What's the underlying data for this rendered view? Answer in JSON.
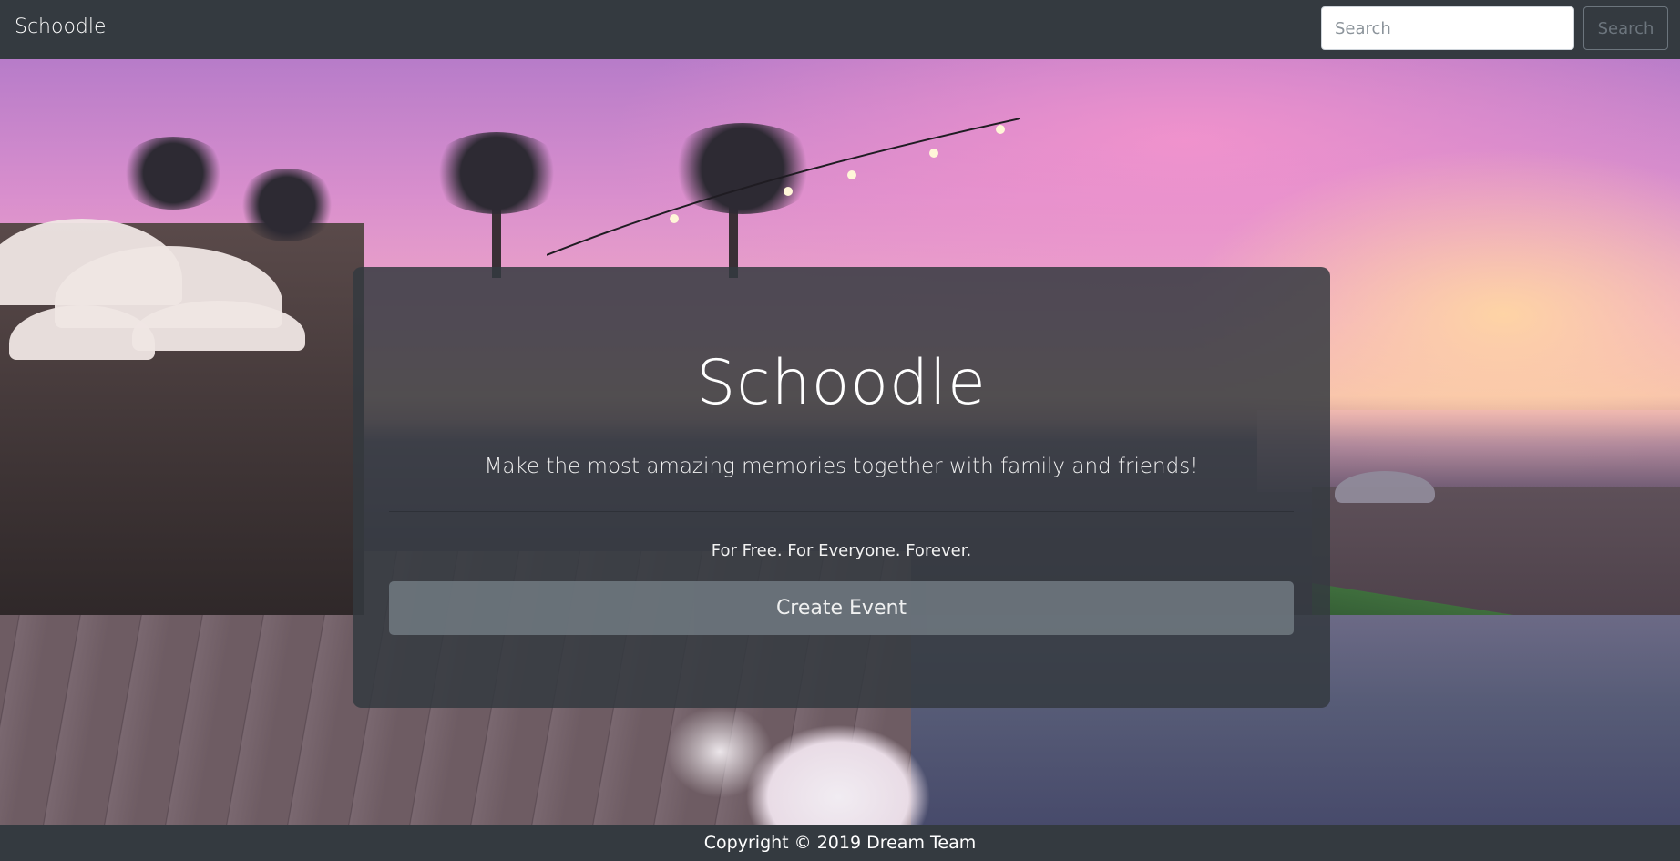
{
  "navbar": {
    "brand": "Schoodle",
    "search_placeholder": "Search",
    "search_value": "",
    "search_button_label": "Search"
  },
  "hero": {
    "background_description_icon": "beach-sunset-photo",
    "title": "Schoodle",
    "lead": "Make the most amazing memories together with family and friends!",
    "tagline": "For Free. For Everyone. Forever.",
    "cta_label": "Create Event"
  },
  "footer": {
    "copyright": "Copyright © 2019 Dream Team"
  },
  "colors": {
    "navbar_bg": "#343a40",
    "footer_bg": "#343a40",
    "button_secondary": "#6c757d",
    "text_light": "#ffffff"
  }
}
